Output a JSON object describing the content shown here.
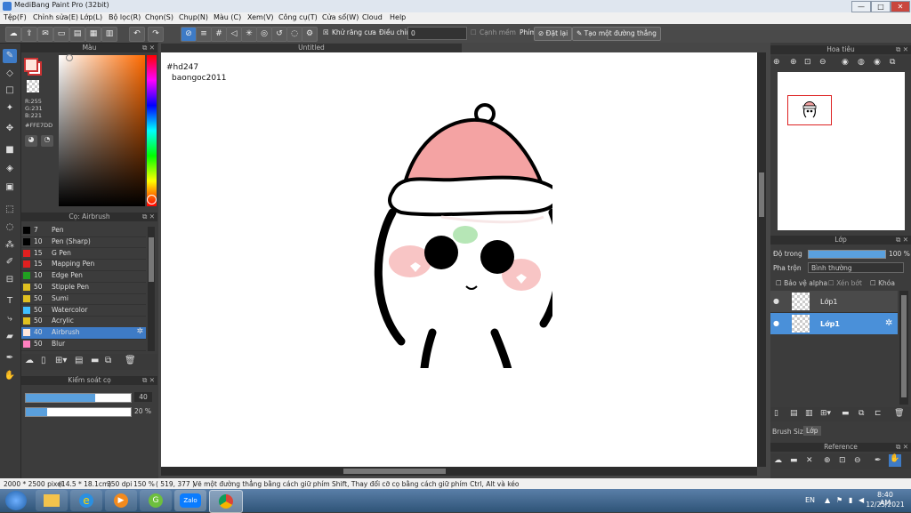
{
  "window": {
    "title": "MediBang Paint Pro (32bit)",
    "min": "—",
    "max": "□",
    "close": "✕"
  },
  "menu": [
    "Tệp(F)",
    "Chỉnh sửa(E)",
    "Lớp(L)",
    "Bộ lọc(R)",
    "Chọn(S)",
    "Chụp(N)",
    "Màu (C)",
    "Xem(V)",
    "Công cụ(T)",
    "Cửa sổ(W)",
    "Cloud",
    "Help"
  ],
  "toolbar": {
    "antialias_label": "Khử răng cưa",
    "adjust_label": "Điều chỉnh",
    "adjust_value": "0",
    "edge_label": "Cạnh mềm",
    "key_label": "Phím",
    "reset_label": "Đặt lại",
    "create_line_label": "Tạo một đường thẳng"
  },
  "color_panel": {
    "title": "Màu",
    "r": "R:255",
    "g": "G:231",
    "b": "B:221",
    "hex": "#FFE7DD",
    "fg_color": "#ffe7dd",
    "bg_color": "#ffffff"
  },
  "brush_panel": {
    "title": "Cọ: Airbrush",
    "brushes": [
      {
        "size": "7",
        "name": "Pen",
        "color": "#000000"
      },
      {
        "size": "10",
        "name": "Pen (Sharp)",
        "color": "#000000"
      },
      {
        "size": "15",
        "name": "G Pen",
        "color": "#e02020"
      },
      {
        "size": "15",
        "name": "Mapping Pen",
        "color": "#e02020"
      },
      {
        "size": "10",
        "name": "Edge Pen",
        "color": "#20a020"
      },
      {
        "size": "50",
        "name": "Stipple Pen",
        "color": "#e0c020"
      },
      {
        "size": "50",
        "name": "Sumi",
        "color": "#e0c020"
      },
      {
        "size": "50",
        "name": "Watercolor",
        "color": "#40c0ff"
      },
      {
        "size": "50",
        "name": "Acrylic",
        "color": "#e0c020"
      },
      {
        "size": "40",
        "name": "Airbrush",
        "color": "#ffe7dd"
      },
      {
        "size": "50",
        "name": "Blur",
        "color": "#ff80c0"
      }
    ],
    "selected_index": 9
  },
  "brush_control": {
    "title": "Kiểm soát cọ",
    "size_value": "40",
    "opacity_value": "20 %",
    "size_level": 0.66,
    "opacity_level": 0.2
  },
  "canvas": {
    "tab_title": "Untitled",
    "text_line1": "#hd247",
    "text_line2": "baongoc2011"
  },
  "navigator": {
    "title": "Hoa tiêu"
  },
  "layer_panel": {
    "title": "Lớp",
    "opacity_label": "Độ trong",
    "opacity_value": "100 %",
    "blend_label": "Pha trộn",
    "blend_value": "Bình thường",
    "protect_alpha": "Bảo vệ alpha",
    "clip": "Xén bớt",
    "lock": "Khóa",
    "layers": [
      {
        "name": "Lớp1"
      },
      {
        "name": "Lớp1"
      }
    ],
    "tab_brush_size": "Brush Size",
    "tab_layer": "Lớp"
  },
  "reference_panel": {
    "title": "Reference"
  },
  "status": {
    "size": "2000 * 2500 pixel",
    "dims": "(14.5 * 18.1cm)",
    "dpi": "350 dpi",
    "zoom": "150 %",
    "coords": "( 519, 377 )",
    "hint": "Vẽ một đường thẳng bằng cách giữ phím Shift, Thay đổi cỡ cọ bằng cách giữ phím Ctrl, Alt và kéo"
  },
  "taskbar": {
    "lang": "EN",
    "time": "8:40 AM",
    "date": "12/25/2021",
    "zalo": "Zalo"
  }
}
